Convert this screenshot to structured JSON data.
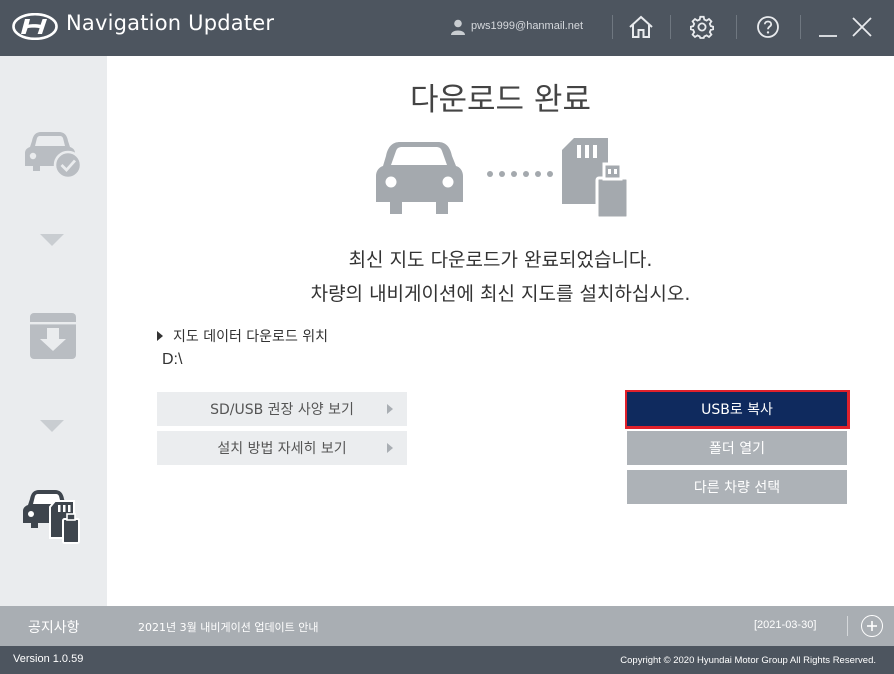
{
  "titlebar": {
    "app_title": "Navigation Updater",
    "user_email": "pws1999@hanmail.net",
    "icons": [
      "hyundai-logo",
      "user-icon",
      "home-icon",
      "gear-icon",
      "help-icon",
      "minimize-icon",
      "close-icon"
    ]
  },
  "sidebar": {
    "steps": [
      "car-check-icon",
      "download-box-icon",
      "car-sd-card-icon"
    ]
  },
  "main": {
    "title": "다운로드 완료",
    "message_line1": "최신 지도 다운로드가 완료되었습니다.",
    "message_line2": "차량의 내비게이션에 최신 지도를 설치하십시오.",
    "location_label": "지도 데이터 다운로드 위치",
    "location_path": "D:\\",
    "info_buttons": {
      "spec": "SD/USB 권장 사양 보기",
      "install": "설치 방법 자세히 보기"
    },
    "actions": {
      "usb_copy": "USB로 복사",
      "open_folder": "폴더 열기",
      "select_other": "다른 차량 선택"
    }
  },
  "notice": {
    "label": "공지사항",
    "text": "2021년 3월 내비게이션 업데이트 안내",
    "date": "[2021-03-30]"
  },
  "footer": {
    "version": "Version 1.0.59",
    "copyright": "Copyright © 2020 Hyundai Motor Group All Rights Reserved."
  },
  "colors": {
    "titlebar": "#4d555f",
    "primary_button": "#0f2a5e",
    "gray_button": "#adb2b7",
    "highlight_outline": "#e0212b"
  }
}
